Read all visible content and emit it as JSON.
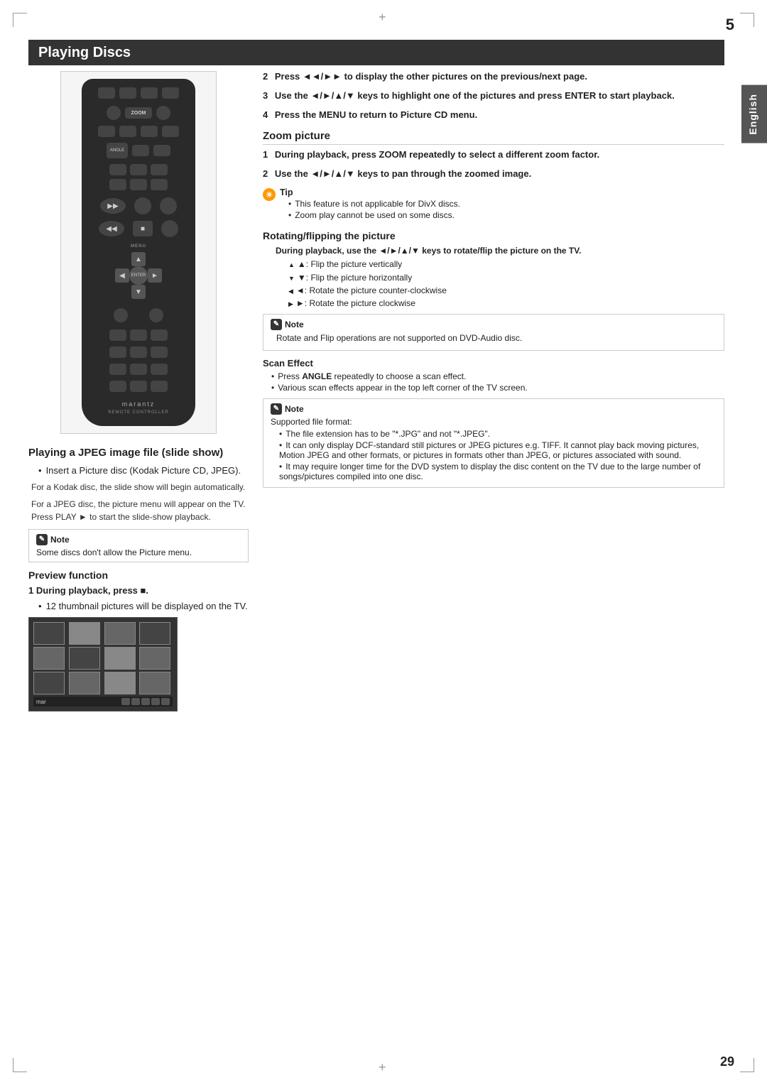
{
  "page": {
    "number_top": "5",
    "number_bottom": "29",
    "language_tab": "English"
  },
  "header": {
    "title": "Playing Discs"
  },
  "right_col": {
    "step2": {
      "num": "2",
      "text": "Press ◄◄/►► to display the other pictures on the previous/next page."
    },
    "step3": {
      "num": "3",
      "text": "Use the ◄/►/▲/▼ keys to highlight one of the pictures and press ENTER to start playback."
    },
    "step4": {
      "num": "4",
      "text": "Press the MENU to return to Picture CD menu."
    },
    "zoom_title": "Zoom picture",
    "zoom_step1": {
      "num": "1",
      "text": "During playback, press ZOOM repeatedly to select a different zoom factor."
    },
    "zoom_step2": {
      "num": "2",
      "text": "Use the ◄/►/▲/▼ keys to pan through the zoomed image."
    },
    "tip_title": "Tip",
    "tip1": "This feature is not applicable for DivX discs.",
    "tip2": "Zoom play cannot be used on some discs.",
    "rotate_title": "Rotating/flipping the picture",
    "rotate_bullet": "During playback, use the ◄/►/▲/▼ keys to rotate/flip the picture on the TV.",
    "rotate_up": "▲: Flip the picture vertically",
    "rotate_down": "▼: Flip the picture horizontally",
    "rotate_left": "◄: Rotate the picture counter-clockwise",
    "rotate_right": "►: Rotate the picture clockwise",
    "note1_title": "Note",
    "note1_text": "Rotate and Flip operations are not supported on DVD-Audio disc.",
    "scan_effect_title": "Scan Effect",
    "scan1": "Press ANGLE repeatedly to choose a scan effect.",
    "scan2": "Various scan effects appear in the top left corner of the TV screen.",
    "note2_title": "Note",
    "note2_sub": "Supported file format:",
    "note2_1": "The file extension has to be \"*.JPG\" and not \"*.JPEG\".",
    "note2_2": "It can only display DCF-standard still pictures or JPEG pictures e.g. TIFF. It cannot play back moving pictures, Motion JPEG and other formats, or pictures in formats other than JPEG, or pictures associated with sound.",
    "note2_3": "It may require longer time for the DVD system to display the disc content on the TV due to the large number of songs/pictures compiled into one disc."
  },
  "left_col": {
    "jpeg_title": "Playing a JPEG image file (slide show)",
    "bullet1": "Insert a Picture disc (Kodak Picture CD, JPEG).",
    "sub1": "For a Kodak disc, the slide show will begin automatically.",
    "sub2": "For a JPEG disc, the picture menu will appear on the TV. Press PLAY ► to start the slide-show playback.",
    "note_title": "Note",
    "note_text": "Some discs don't allow the Picture menu.",
    "preview_title": "Preview function",
    "step1": "During playback, press ■.",
    "step1_bullet": "12 thumbnail pictures will be displayed on the TV."
  },
  "remote": {
    "zoom_label": "ZOOM",
    "angle_label": "ANGLE",
    "menu_label": "MENU",
    "enter_label": "ENTER",
    "brand": "marantz",
    "brand_sub": "REMOTE CONTROLLER"
  }
}
